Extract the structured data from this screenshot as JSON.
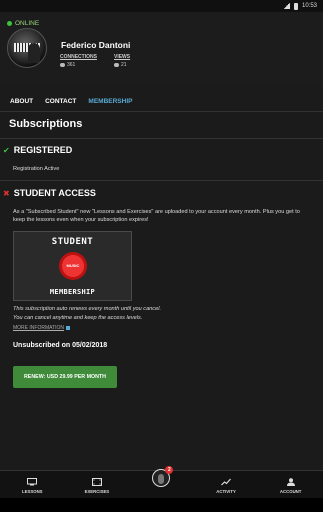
{
  "status_bar": {
    "time": "10:53"
  },
  "profile": {
    "status": "ONLINE",
    "name": "Federico Dantoni",
    "connections_label": "CONNECTIONS",
    "connections_value": "361",
    "views_label": "VIEWS",
    "views_value": "21"
  },
  "tabs": [
    {
      "label": "ABOUT",
      "active": false
    },
    {
      "label": "CONTACT",
      "active": false
    },
    {
      "label": "MEMBERSHIP",
      "active": true
    }
  ],
  "page_title": "Subscriptions",
  "registered": {
    "heading": "REGISTERED",
    "text": "Registration Active"
  },
  "student_access": {
    "heading": "STUDENT ACCESS",
    "description": "As a \"Subscribed Student\" new \"Lessons and Exercises\" are uploaded to your account every month. Plus you get to keep the lessons even when your subscription expires!",
    "card_top": "STUDENT",
    "card_bottom": "MEMBERSHIP",
    "logo_text": "MUSIC",
    "auto_renew_note": "This subscription auto renews every month until you cancel.",
    "cancel_note": "You can cancel anytime and keep the access levels.",
    "more_info": "MORE INFORMATION",
    "unsubscribed": "Unsubscribed on 05/02/2018",
    "renew_button": "RENEW: USD 29.99 PER MONTH"
  },
  "bottom_nav": [
    {
      "label": "LESSONS",
      "icon": "monitor-icon"
    },
    {
      "label": "EXERCISES",
      "icon": "film-icon"
    },
    {
      "label": "",
      "icon": "profile-photo",
      "badge": "2"
    },
    {
      "label": "ACTIVITY",
      "icon": "chart-line-icon"
    },
    {
      "label": "ACCOUNT",
      "icon": "user-icon"
    }
  ],
  "colors": {
    "accent": "#5aaad6",
    "online": "#3ac43a",
    "error": "#e03030",
    "button": "#3f8b3a",
    "background": "#1b1b1b"
  }
}
